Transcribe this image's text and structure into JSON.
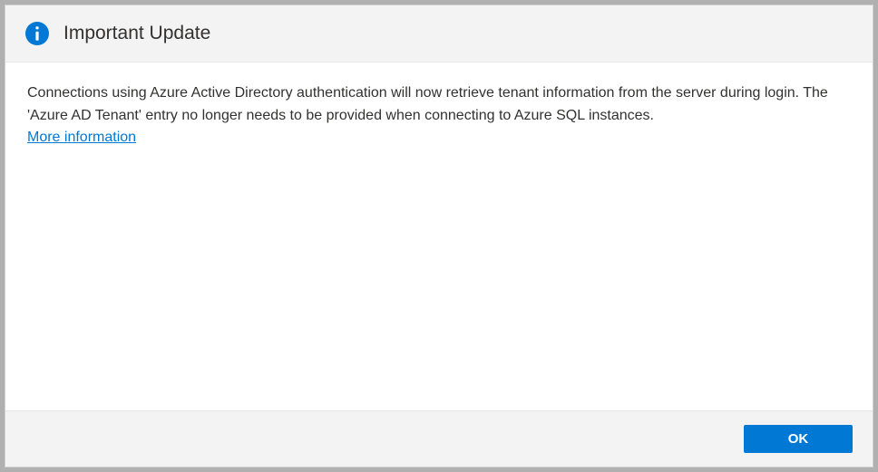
{
  "header": {
    "title": "Important Update"
  },
  "content": {
    "message": "Connections using Azure Active Directory authentication will now retrieve tenant information from the server during login. The 'Azure AD Tenant' entry no longer needs to be provided when connecting to Azure SQL instances.",
    "link_label": "More information"
  },
  "footer": {
    "ok_label": "OK"
  }
}
